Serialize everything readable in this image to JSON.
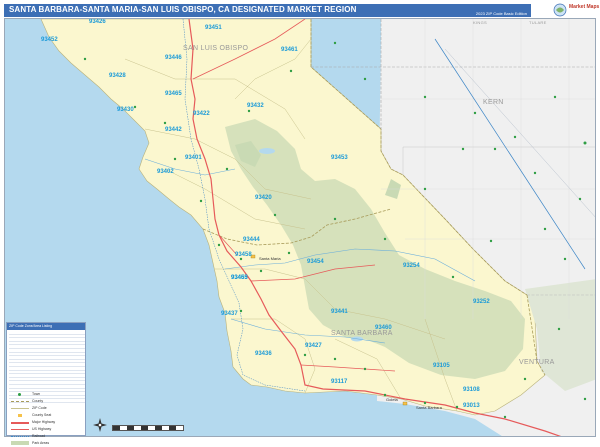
{
  "map": {
    "title": "SANTA BARBARA-SANTA MARIA-SAN LUIS OBISPO, CA DESIGNATED MARKET REGION",
    "edition": "2023 ZIP Code Basic Edition",
    "colors": {
      "water": "#b4d9ee",
      "region": "#fbf7cf",
      "outside": "#f0f0f0",
      "forest": "#c9dab4",
      "title_bar": "#3d6fb5",
      "zip_label": "#1c9bd8",
      "highway": "#e65a5a",
      "rail": "#3d86c6"
    },
    "counties": [
      {
        "name": "SAN LUIS OBISPO"
      },
      {
        "name": "KERN"
      },
      {
        "name": "SANTA BARBARA"
      },
      {
        "name": "VENTURA"
      },
      {
        "name": "TULARE"
      },
      {
        "name": "KINGS"
      }
    ],
    "cities": [
      {
        "name": "Santa Maria"
      },
      {
        "name": "Goleta"
      },
      {
        "name": "Santa Barbara"
      }
    ],
    "zip_codes": [
      "93426",
      "93451",
      "93452",
      "93446",
      "93461",
      "93428",
      "93465",
      "93430",
      "93432",
      "93422",
      "93442",
      "93402",
      "93453",
      "93401",
      "93420",
      "93444",
      "93458",
      "93455",
      "93454",
      "93254",
      "93252",
      "93463",
      "93441",
      "93437",
      "93460",
      "93436",
      "93427",
      "93117",
      "93105",
      "93108",
      "93013"
    ],
    "legend": {
      "title": "ZIP Code Zone/Area Listing",
      "items": [
        {
          "icon": "town-dot",
          "label": "Town"
        },
        {
          "icon": "county-line",
          "label": "County"
        },
        {
          "icon": "zip-line",
          "label": "ZIP Code"
        },
        {
          "icon": "county-seat",
          "label": "County Seat"
        },
        {
          "icon": "interstate-line",
          "label": "Major Highway"
        },
        {
          "icon": "us-highway-line",
          "label": "US Highway"
        },
        {
          "icon": "rail-line",
          "label": "Railroad"
        },
        {
          "icon": "park-area",
          "label": "Park Areas"
        }
      ]
    },
    "logo_text": "Market Maps"
  }
}
